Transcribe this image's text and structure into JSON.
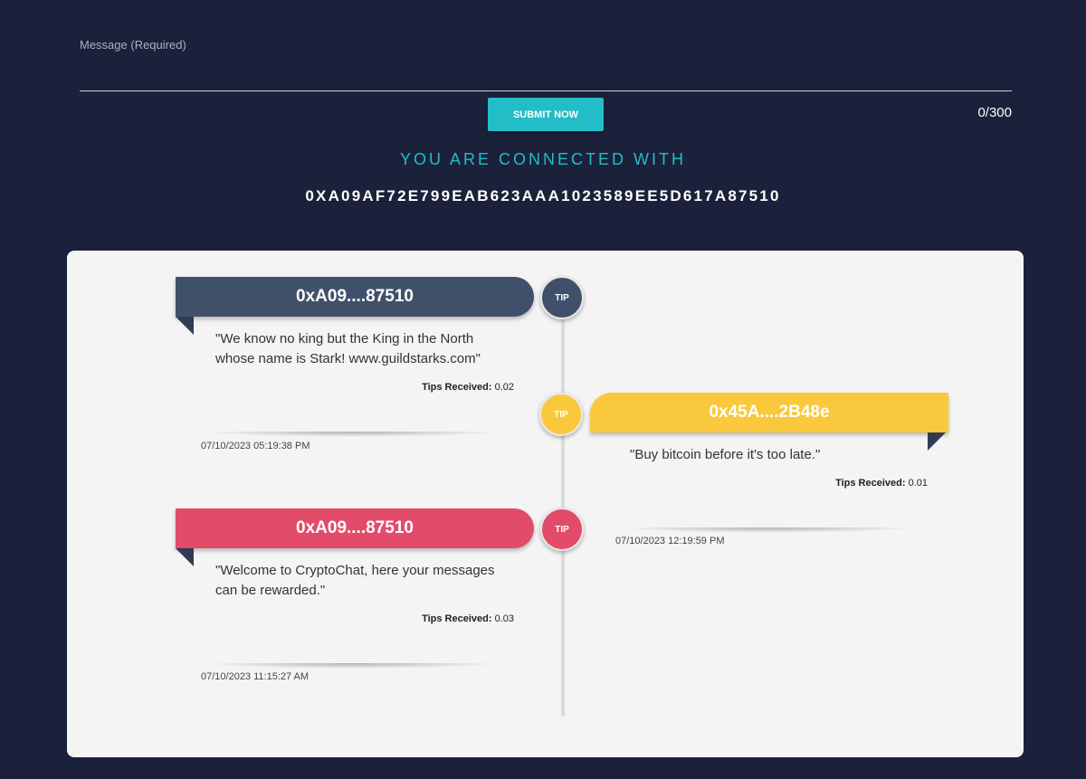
{
  "form": {
    "message_label": "Message (Required)",
    "message_value": "",
    "submit_label": "SUBMIT NOW",
    "counter": "0/300"
  },
  "connection": {
    "title": "YOU ARE CONNECTED WITH",
    "address": "0XA09AF72E799EAB623AAA1023589EE5D617A87510"
  },
  "messages": [
    {
      "side": "left",
      "sender": "0xA09....87510",
      "color": "#41506a",
      "tip_label": "TIP",
      "text": "\"We know no king but the King in the North whose name is Stark! www.guildstarks.com\"",
      "tips_label": "Tips Received:",
      "tips_value": "0.02",
      "timestamp": "07/10/2023 05:19:38 PM"
    },
    {
      "side": "right",
      "sender": "0x45A....2B48e",
      "color": "#f9c83c",
      "tip_label": "TIP",
      "text": "\"Buy bitcoin before it's too late.\"",
      "tips_label": "Tips Received:",
      "tips_value": "0.01",
      "timestamp": "07/10/2023 12:19:59 PM"
    },
    {
      "side": "left",
      "sender": "0xA09....87510",
      "color": "#e24b69",
      "tip_label": "TIP",
      "text": "\"Welcome to CryptoChat, here your messages can be rewarded.\"",
      "tips_label": "Tips Received:",
      "tips_value": "0.03",
      "timestamp": "07/10/2023 11:15:27 AM"
    }
  ]
}
